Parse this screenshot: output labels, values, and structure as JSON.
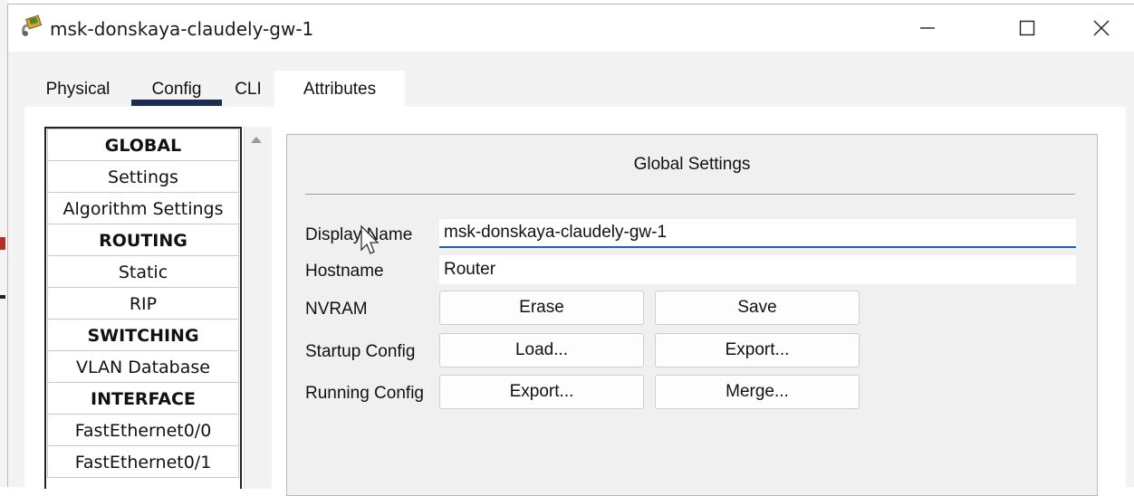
{
  "window": {
    "title": "msk-donskaya-claudely-gw-1",
    "icon": "router-app-icon"
  },
  "titlebar_buttons": [
    "minimize-icon",
    "maximize-icon",
    "close-icon"
  ],
  "tabs": [
    {
      "label": "Physical",
      "selected": false
    },
    {
      "label": "Config",
      "selected": true
    },
    {
      "label": "CLI",
      "selected": false
    },
    {
      "label": "Attributes",
      "selected": false
    }
  ],
  "nav": {
    "items": [
      {
        "label": "GLOBAL",
        "header": true
      },
      {
        "label": "Settings",
        "header": false
      },
      {
        "label": "Algorithm Settings",
        "header": false
      },
      {
        "label": "ROUTING",
        "header": true
      },
      {
        "label": "Static",
        "header": false
      },
      {
        "label": "RIP",
        "header": false
      },
      {
        "label": "SWITCHING",
        "header": true
      },
      {
        "label": "VLAN Database",
        "header": false
      },
      {
        "label": "INTERFACE",
        "header": true
      },
      {
        "label": "FastEthernet0/0",
        "header": false
      },
      {
        "label": "FastEthernet0/1",
        "header": false
      }
    ]
  },
  "panel": {
    "title": "Global Settings",
    "display_name_label": "Display Name",
    "display_name_value": "msk-donskaya-claudely-gw-1",
    "hostname_label": "Hostname",
    "hostname_value": "Router",
    "nvram_label": "NVRAM",
    "nvram_erase": "Erase",
    "nvram_save": "Save",
    "startup_label": "Startup Config",
    "startup_load": "Load...",
    "startup_export": "Export...",
    "running_label": "Running Config",
    "running_export": "Export...",
    "running_merge": "Merge..."
  },
  "colors": {
    "accent": "#1d2d4f",
    "focus": "#1f5fbf",
    "panel_bg": "#f0f0f0"
  }
}
